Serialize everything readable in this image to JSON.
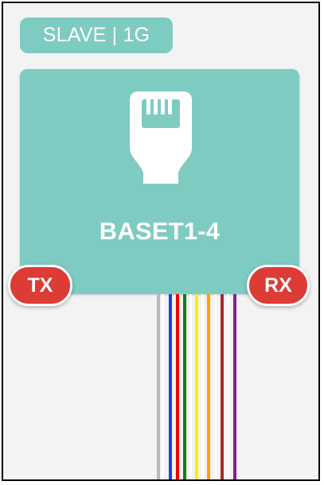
{
  "node": {
    "mode_label": "SLAVE | 1G",
    "port_name": "BASET1-4",
    "port_icon": "ethernet-port-icon",
    "tx_label": "TX",
    "rx_label": "RX"
  },
  "colors": {
    "accent": "#7ecbc2",
    "badge_red": "#dd3b36",
    "frame_border": "#000000",
    "canvas_bg": "#f3f3f3"
  },
  "wires": [
    {
      "name": "wire-gray",
      "color": "#b8b8b8"
    },
    {
      "name": "wire-white",
      "color": "#ffffff"
    },
    {
      "name": "wire-blue",
      "color": "#1d3fe0"
    },
    {
      "name": "wire-red",
      "color": "#f00000"
    },
    {
      "name": "wire-green",
      "color": "#0f7d18"
    },
    {
      "name": "wire-white-2",
      "color": "#ffffff"
    },
    {
      "name": "wire-yellow",
      "color": "#ffee00"
    },
    {
      "name": "wire-white-3",
      "color": "#ffffff"
    },
    {
      "name": "wire-orange",
      "color": "#ffa000"
    },
    {
      "name": "wire-white-4",
      "color": "#ffffff"
    },
    {
      "name": "wire-brown",
      "color": "#a52c2a"
    },
    {
      "name": "wire-white-5",
      "color": "#ffffff"
    },
    {
      "name": "wire-purple",
      "color": "#8a1d97"
    }
  ]
}
